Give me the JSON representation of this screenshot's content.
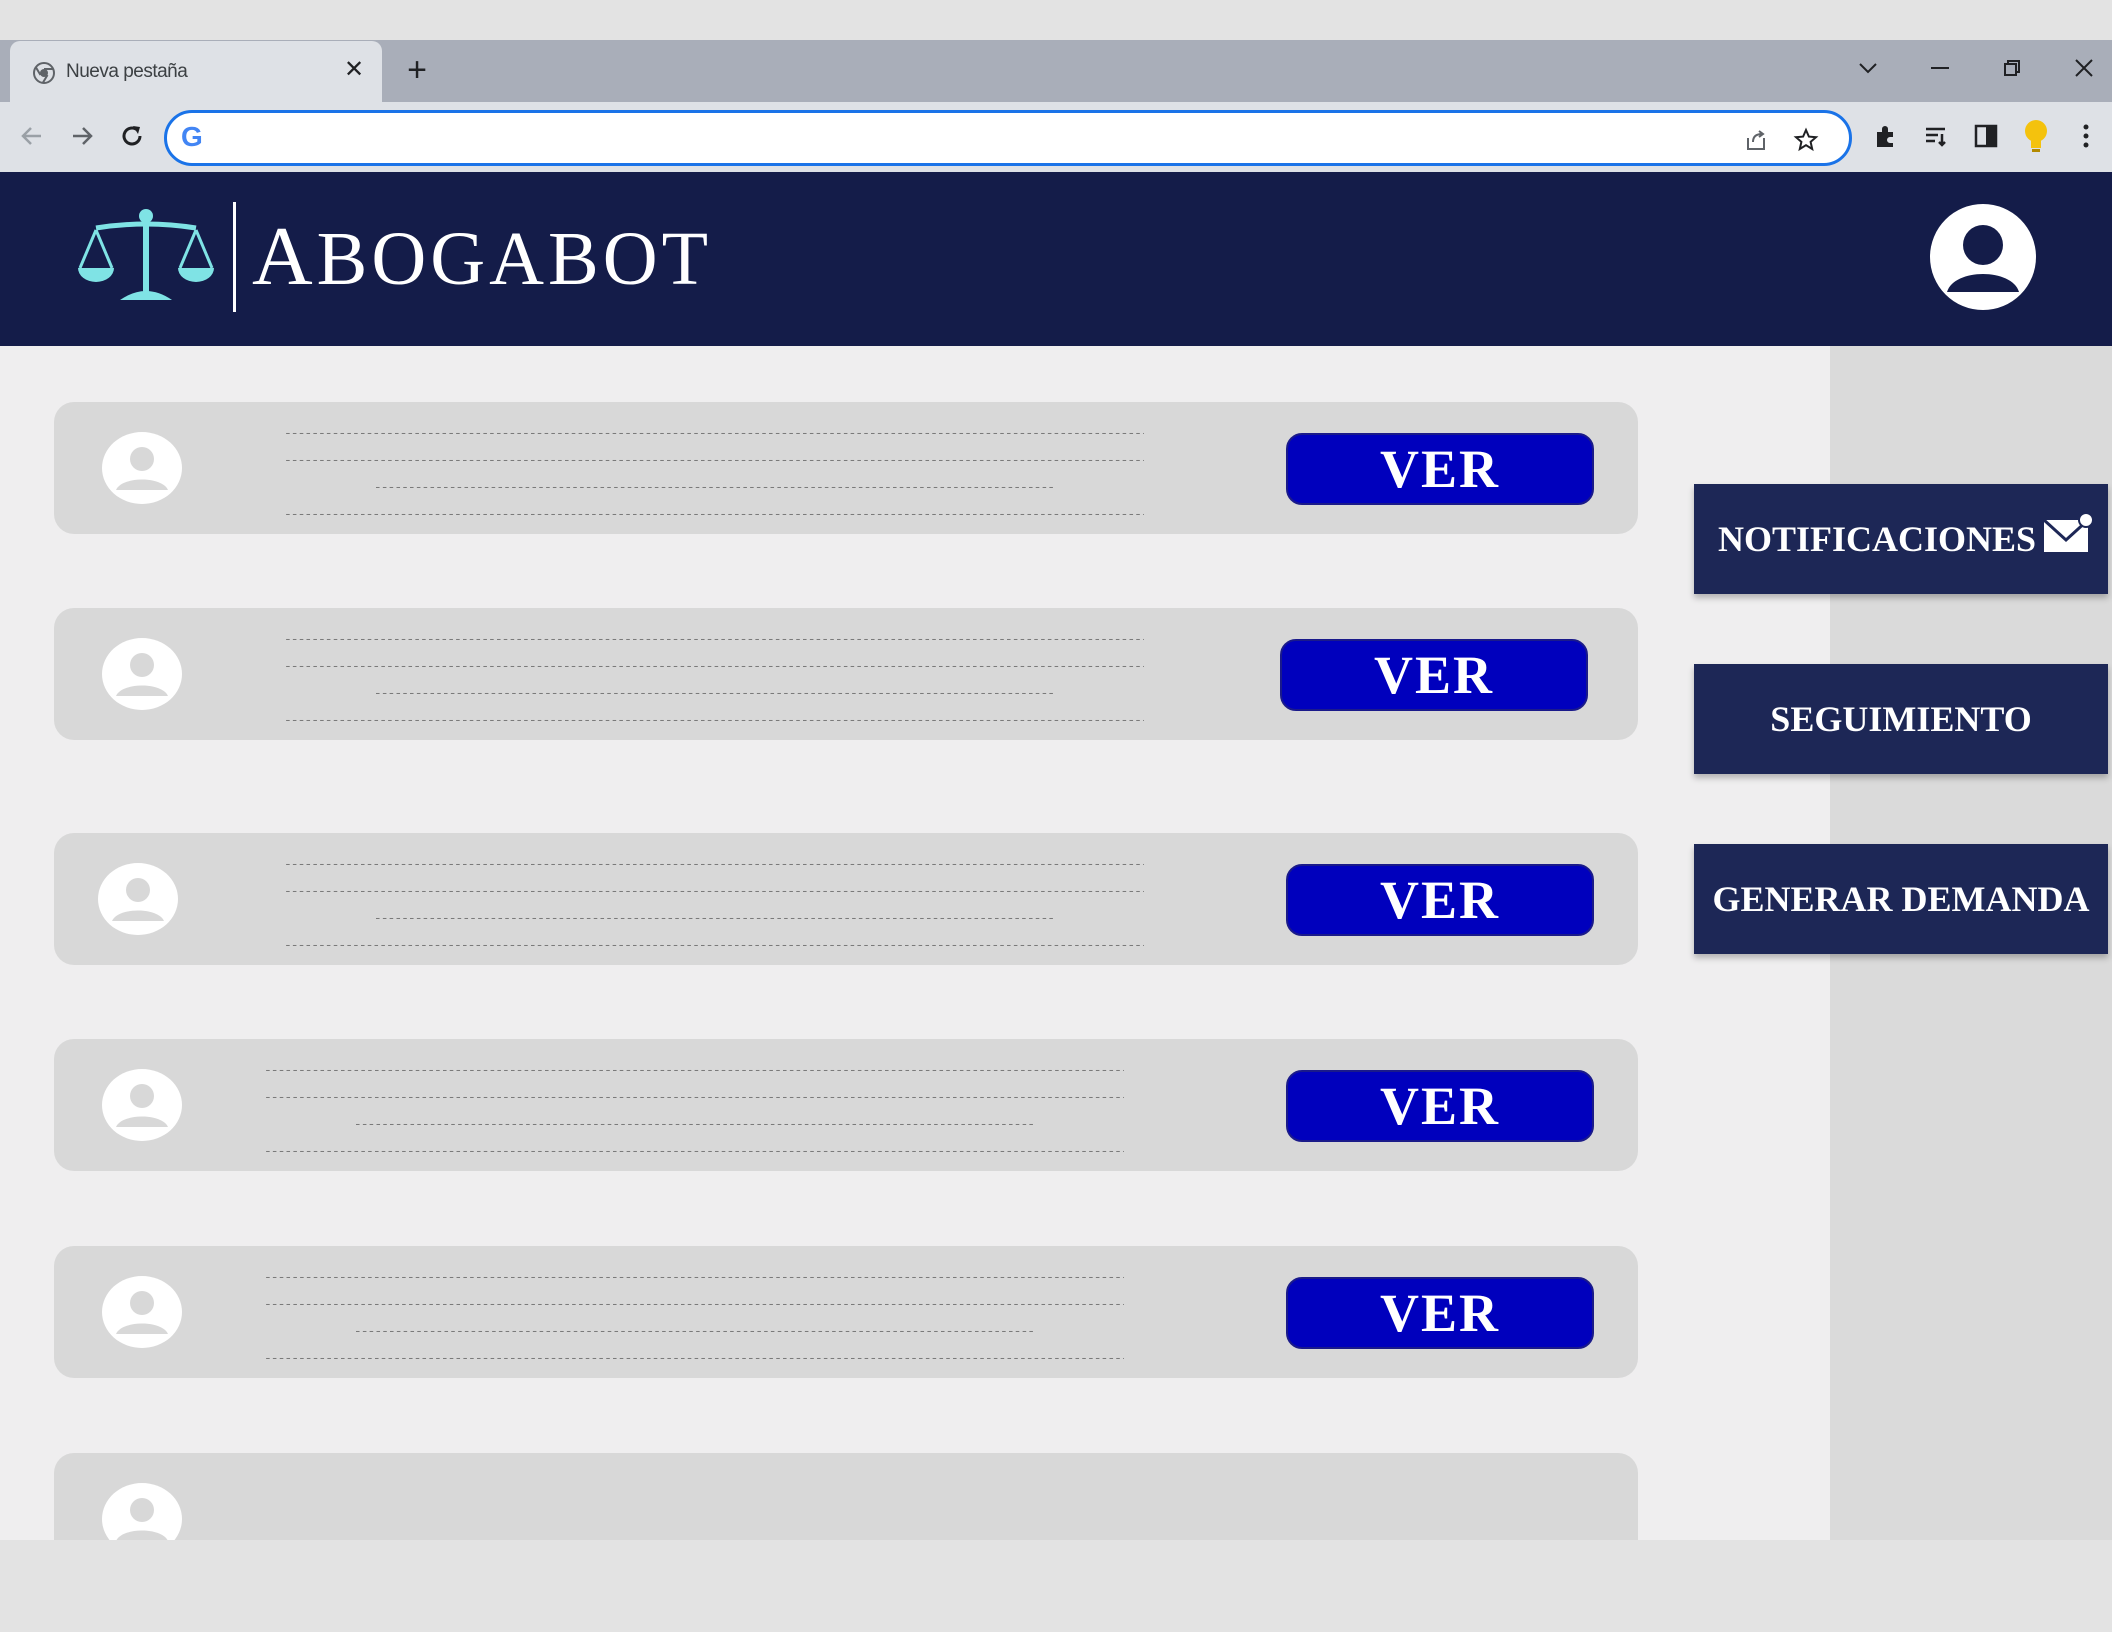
{
  "browser": {
    "tab": {
      "title": "Nueva pestaña",
      "favicon": "chrome-icon"
    },
    "new_tab_label": "+",
    "omnibox": {
      "value": "",
      "placeholder": "",
      "provider_icon": "google-icon"
    },
    "window_controls": [
      "chevron-down-icon",
      "minimize-icon",
      "restore-icon",
      "close-icon"
    ],
    "toolbar_icons": [
      "back-icon",
      "forward-icon",
      "reload-icon",
      "share-icon",
      "star-icon",
      "extensions-icon",
      "reading-list-icon",
      "side-panel-icon",
      "bulb-icon",
      "kebab-menu-icon"
    ]
  },
  "app": {
    "brand": {
      "cap": "A",
      "rest": "BOGABOT",
      "logo": "scales-of-justice-icon"
    },
    "profile_icon": "user-avatar-icon",
    "colors": {
      "header_bg": "#141c49",
      "accent_cyan": "#7fe3e5",
      "button_blue": "#0000bd",
      "side_button_bg": "#1d2756"
    }
  },
  "cases": {
    "button_label": "VER",
    "items": [
      {
        "lines": [
          "--------------------------------------------------------------------------------------------------------------------------------------------------------------------------------",
          "------------------------------------------------------------------------------------------------------------------------------------------------------------",
          "----------------------------------------------------------------------------------------------------",
          "------------------------------------------------------------------------------------------------------------------------------------------------------------------------------------"
        ]
      },
      {
        "lines": [
          "--------------------------------------------------------------------------------------------------------------------------------------------------------------------------------",
          "------------------------------------------------------------------------------------------------------------------------------------------------------------",
          "----------------------------------------------------------------------------------------------------",
          "------------------------------------------------------------------------------------------------------------------------------------------------------------------------------------"
        ]
      },
      {
        "lines": [
          "--------------------------------------------------------------------------------------------------------------------------------------------------------------------------------",
          "------------------------------------------------------------------------------------------------------------------------------------------------------------",
          "----------------------------------------------------------------------------------------------------",
          "------------------------------------------------------------------------------------------------------------------------------------------------------------------------------------"
        ]
      },
      {
        "lines": [
          "--------------------------------------------------------------------------------------------------------------------------------------------------------------------------------",
          "------------------------------------------------------------------------------------------------------------------------------------------------------------",
          "----------------------------------------------------------------------------------------------------",
          "------------------------------------------------------------------------------------------------------------------------------------------------------------------------------------"
        ]
      },
      {
        "lines": [
          "--------------------------------------------------------------------------------------------------------------------------------------------------------------------------------",
          "------------------------------------------------------------------------------------------------------------------------------------------------------------",
          "----------------------------------------------------------------------------------------------------",
          "------------------------------------------------------------------------------------------------------------------------------------------------------------------------------------"
        ]
      }
    ]
  },
  "sidebar": {
    "notifications_label": "NOTIFICACIONES",
    "notifications_icon": "mail-icon",
    "tracking_label": "SEGUIMIENTO",
    "generate_label": "GENERAR DEMANDA"
  }
}
